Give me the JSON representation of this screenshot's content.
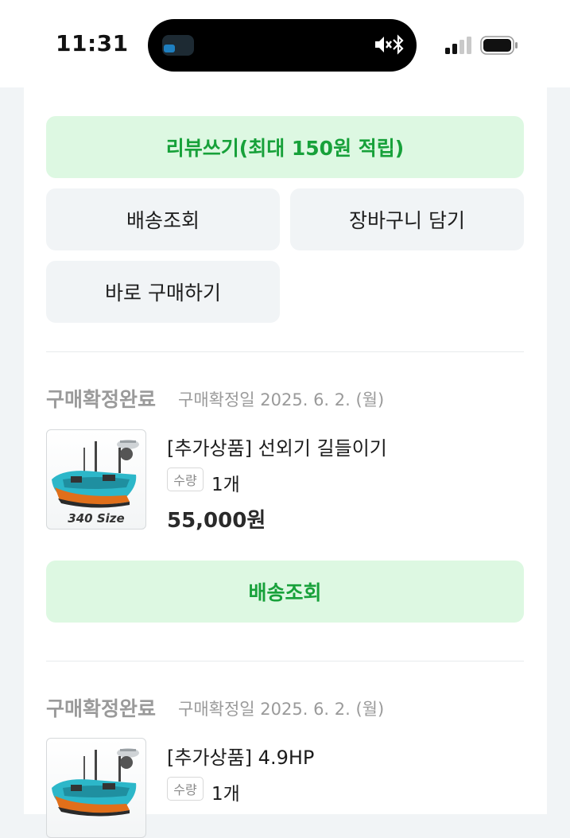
{
  "status_bar": {
    "time": "11:31"
  },
  "top_actions": {
    "review_label": "리뷰쓰기(최대 150원 적립)",
    "track_label": "배송조회",
    "cart_label": "장바구니 담기",
    "buy_now_label": "바로 구매하기"
  },
  "orders": [
    {
      "status": "구매확정완료",
      "date": "구매확정일 2025. 6. 2. (월)",
      "product_name": "[추가상품] 선외기 길들이기",
      "qty_label": "수량",
      "qty": "1개",
      "price": "55,000원",
      "thumb_caption": "340 Size",
      "track_label": "배송조회"
    },
    {
      "status": "구매확정완료",
      "date": "구매확정일 2025. 6. 2. (월)",
      "product_name": "[추가상품] 4.9HP",
      "qty_label": "수량",
      "qty": "1개"
    }
  ],
  "colors": {
    "accent_green": "#17a13a",
    "green_bg": "#ddf8e2",
    "gray_bg": "#f1f4f6"
  }
}
